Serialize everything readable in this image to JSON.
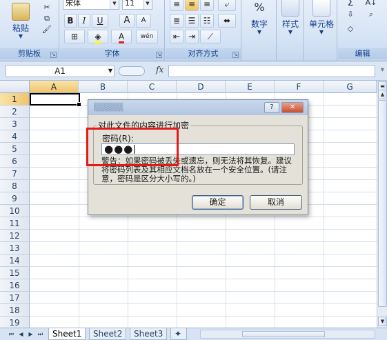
{
  "ribbon": {
    "clipboard": {
      "paste_label": "粘贴",
      "group_label": "剪贴板"
    },
    "font": {
      "font_name": "宋体",
      "font_size": "11",
      "bold": "B",
      "italic": "I",
      "underline": "U",
      "grow": "A",
      "shrink": "A",
      "font_color": "A",
      "phonetic": "wén",
      "group_label": "字体"
    },
    "alignment": {
      "group_label": "对齐方式"
    },
    "number": {
      "label": "数字",
      "symbol": "%"
    },
    "styles": {
      "label": "样式"
    },
    "cells": {
      "label": "单元格"
    },
    "editing": {
      "group_label": "编辑",
      "sum_symbol": "Σ",
      "sort_symbol": "A↓"
    }
  },
  "formula_bar": {
    "name_box": "A1",
    "fx_label": "fx",
    "formula": ""
  },
  "grid": {
    "columns": [
      "A",
      "B",
      "C",
      "D",
      "E",
      "F",
      "G"
    ],
    "rows": [
      "1",
      "2",
      "3",
      "4",
      "5",
      "6",
      "7",
      "8",
      "9",
      "10",
      "11",
      "12",
      "13",
      "14",
      "15",
      "16",
      "17",
      "18",
      "19"
    ],
    "active_cell": "A1"
  },
  "sheet_tabs": [
    "Sheet1",
    "Sheet2",
    "Sheet3"
  ],
  "dialog": {
    "group_title": "对此文件的内容进行加密",
    "password_label": "密码(R):",
    "password_mask": "●●●",
    "warning": "警告：如果密码被丢失或遗忘，则无法将其恢复。建议将密码列表及其相应文档名放在一个安全位置。(请注意，密码是区分大小写的。)",
    "ok_label": "确定",
    "cancel_label": "取消",
    "help_label": "?",
    "close_label": "✕"
  },
  "colors": {
    "highlight": "#e11a1a",
    "dialog_bg": "#e3e1d8",
    "ribbon_bg": "#d7e4f5"
  }
}
